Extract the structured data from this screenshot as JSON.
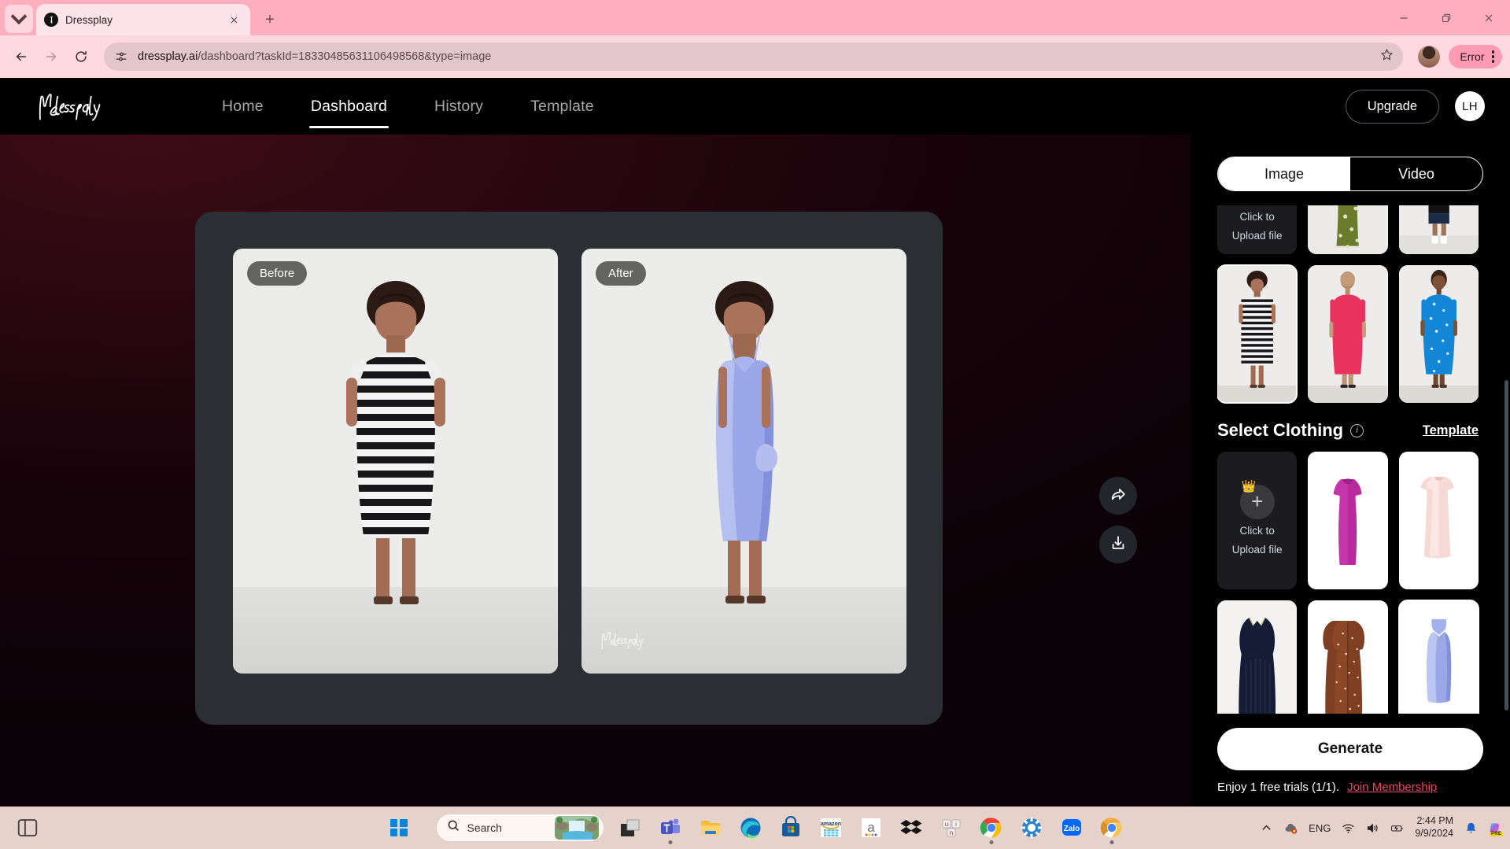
{
  "browser": {
    "tab": {
      "title": "Dressplay",
      "favicon_icon": "dressplay-favicon",
      "close_icon": "close-icon"
    },
    "tabstrip_caret_icon": "chevron-down-icon",
    "new_tab_icon": "plus-icon",
    "window_controls": {
      "minimize": "minimize-icon",
      "maximize": "restore-icon",
      "close": "close-icon"
    },
    "nav": {
      "back_icon": "back-arrow-icon",
      "forward_icon": "forward-arrow-icon",
      "reload_icon": "reload-icon"
    },
    "omnibox": {
      "site_info_icon": "site-settings-icon",
      "url_domain": "dressplay.ai",
      "url_path": "/dashboard?taskId=18330485631106498568&type=image",
      "bookmark_icon": "star-icon"
    },
    "profile_avatar_icon": "profile-avatar",
    "error_badge": {
      "label": "Error",
      "menu_icon": "three-dot-menu-icon"
    }
  },
  "app": {
    "brand": "Dressplay",
    "nav_items": [
      {
        "label": "Home",
        "active": false
      },
      {
        "label": "Dashboard",
        "active": true
      },
      {
        "label": "History",
        "active": false
      },
      {
        "label": "Template",
        "active": false
      }
    ],
    "upgrade_label": "Upgrade",
    "user_initials": "LH"
  },
  "result": {
    "before_label": "Before",
    "after_label": "After",
    "watermark": "Dressplay",
    "share_icon": "share-icon",
    "download_icon": "download-icon"
  },
  "panel": {
    "mode_tabs": [
      {
        "label": "Image",
        "active": true
      },
      {
        "label": "Video",
        "active": false
      }
    ],
    "model_grid": {
      "upload_tile": {
        "line1": "Click to",
        "line2": "Upload file",
        "plus_icon": "plus-icon",
        "crown_icon": "crown-icon"
      },
      "items": [
        {
          "name": "green-floral-dress-model",
          "selected": false
        },
        {
          "name": "black-navy-outfit-model",
          "selected": false
        },
        {
          "name": "striped-dress-model",
          "selected": true
        },
        {
          "name": "pink-dress-model",
          "selected": false
        },
        {
          "name": "blue-floral-dress-model",
          "selected": false
        }
      ]
    },
    "clothing_section": {
      "title": "Select Clothing",
      "info_icon": "info-icon",
      "template_link": "Template",
      "upload_tile": {
        "line1": "Click to",
        "line2": "Upload file",
        "plus_icon": "plus-icon",
        "crown_icon": "crown-icon"
      },
      "items": [
        {
          "name": "magenta-tshirt-dress",
          "selected": false
        },
        {
          "name": "blush-pink-shift-dress",
          "selected": false
        },
        {
          "name": "navy-pleated-dress",
          "selected": false
        },
        {
          "name": "brown-polka-dress",
          "selected": false
        },
        {
          "name": "lilac-satin-slip-dress",
          "selected": true
        }
      ]
    },
    "generate_label": "Generate",
    "trial_text": "Enjoy 1 free trials (1/1).",
    "membership_link": "Join Membership"
  },
  "taskbar": {
    "start_icon": "windows-start-icon",
    "search": {
      "placeholder": "Search",
      "icon": "search-icon",
      "thumbnail": "waterfall-thumbnail"
    },
    "apps": [
      {
        "name": "task-view-icon"
      },
      {
        "name": "microsoft-teams-icon"
      },
      {
        "name": "file-explorer-icon"
      },
      {
        "name": "microsoft-edge-icon"
      },
      {
        "name": "microsoft-store-icon"
      },
      {
        "name": "amazon-shopping-icon"
      },
      {
        "name": "amazon-app-icon"
      },
      {
        "name": "dropbox-icon"
      },
      {
        "name": "unikey-icon"
      },
      {
        "name": "google-chrome-icon"
      },
      {
        "name": "settings-icon"
      },
      {
        "name": "zalo-icon"
      },
      {
        "name": "chrome-canary-icon"
      }
    ],
    "tray": {
      "overflow_icon": "chevron-up-icon",
      "onedrive_icon": "onedrive-error-icon",
      "language": "ENG",
      "wifi_icon": "wifi-icon",
      "volume_icon": "volume-icon",
      "battery_icon": "battery-charging-icon",
      "time": "2:44 PM",
      "date": "9/9/2024",
      "notifications_icon": "bell-icon",
      "copilot_icon": "copilot-pre-icon"
    }
  },
  "colors": {
    "browser_pink": "#ffb3c1",
    "toolbar_pink": "#ffd9e1",
    "app_black": "#000000",
    "canvas_maroon": "#2a0710",
    "card_gray": "#2b2f33",
    "accent_red": "#f0435f",
    "taskbar_beige": "#e5d2ca"
  }
}
